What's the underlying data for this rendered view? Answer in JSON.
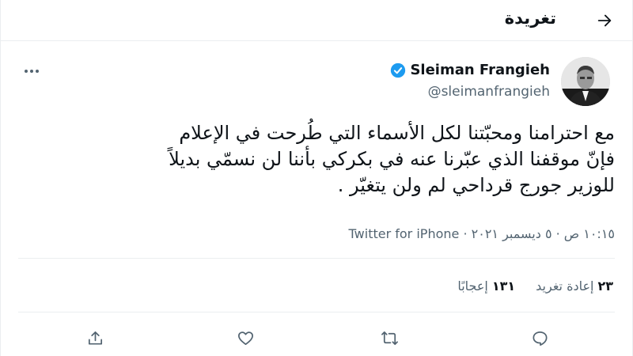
{
  "header": {
    "title": "تغريدة",
    "back_icon": "arrow-back-icon"
  },
  "author": {
    "name": "Sleiman Frangieh",
    "handle": "@sleimanfrangieh",
    "verified": true,
    "verified_color": "#1d9bf0"
  },
  "tweet": {
    "lines": [
      "مع احترامنا ومحبّتنا لكل الأسماء التي طُرحت في الإعلام",
      "فإنّ موقفنا الذي عبّرنا عنه في بكركي بأننا لن نسمّي بديلاً",
      "للوزير جورج قرداحي لم ولن يتغيّر ."
    ],
    "time": "١٠:١٥ ص",
    "date": "٥ ديسمبر ٢٠٢١",
    "source": "Twitter for iPhone"
  },
  "stats": {
    "retweets": {
      "count": "٢٣",
      "label": "إعادة تغريد"
    },
    "likes": {
      "count": "١٣١",
      "label": "إعجابًا"
    }
  },
  "actions": {
    "icons": [
      "reply-icon",
      "retweet-icon",
      "like-icon",
      "share-icon"
    ],
    "icon_color": "#536471"
  }
}
